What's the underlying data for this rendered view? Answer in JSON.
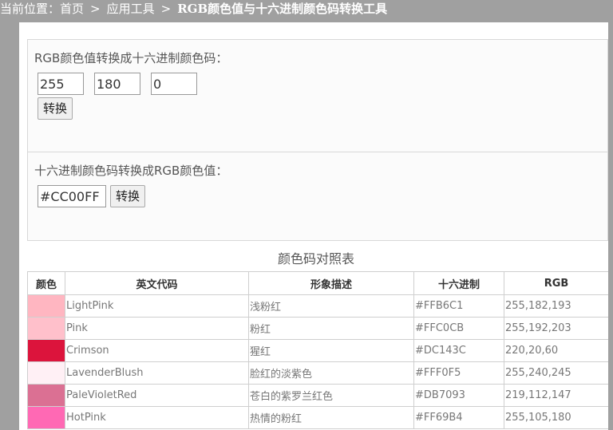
{
  "breadcrumb": {
    "prefix": "当前位置：",
    "home": "首页",
    "section": "应用工具",
    "current": "RGB颜色值与十六进制颜色码转换工具",
    "separator": ">"
  },
  "rgb_to_hex": {
    "title": "RGB颜色值转换成十六进制颜色码：",
    "r": "255",
    "g": "180",
    "b": "0",
    "button": "转换"
  },
  "hex_to_rgb": {
    "title": "十六进制颜色码转换成RGB颜色值：",
    "hex": "#CC00FF",
    "button": "转换"
  },
  "table": {
    "caption": "颜色码对照表",
    "headers": [
      "颜色",
      "英文代码",
      "形象描述",
      "十六进制",
      "RGB"
    ],
    "rows": [
      {
        "color": "#FFB6C1",
        "name": "LightPink",
        "desc": "浅粉红",
        "hex": "#FFB6C1",
        "rgb": "255,182,193"
      },
      {
        "color": "#FFC0CB",
        "name": "Pink",
        "desc": "粉红",
        "hex": "#FFC0CB",
        "rgb": "255,192,203"
      },
      {
        "color": "#DC143C",
        "name": "Crimson",
        "desc": "猩红",
        "hex": "#DC143C",
        "rgb": "220,20,60"
      },
      {
        "color": "#FFF0F5",
        "name": "LavenderBlush",
        "desc": "脸红的淡紫色",
        "hex": "#FFF0F5",
        "rgb": "255,240,245"
      },
      {
        "color": "#DB7093",
        "name": "PaleVioletRed",
        "desc": "苍白的紫罗兰红色",
        "hex": "#DB7093",
        "rgb": "219,112,147"
      },
      {
        "color": "#FF69B4",
        "name": "HotPink",
        "desc": "热情的粉红",
        "hex": "#FF69B4",
        "rgb": "255,105,180"
      }
    ]
  },
  "colors": {
    "page_background": "#a0a0a0",
    "panel_background": "#fbfbfb"
  }
}
